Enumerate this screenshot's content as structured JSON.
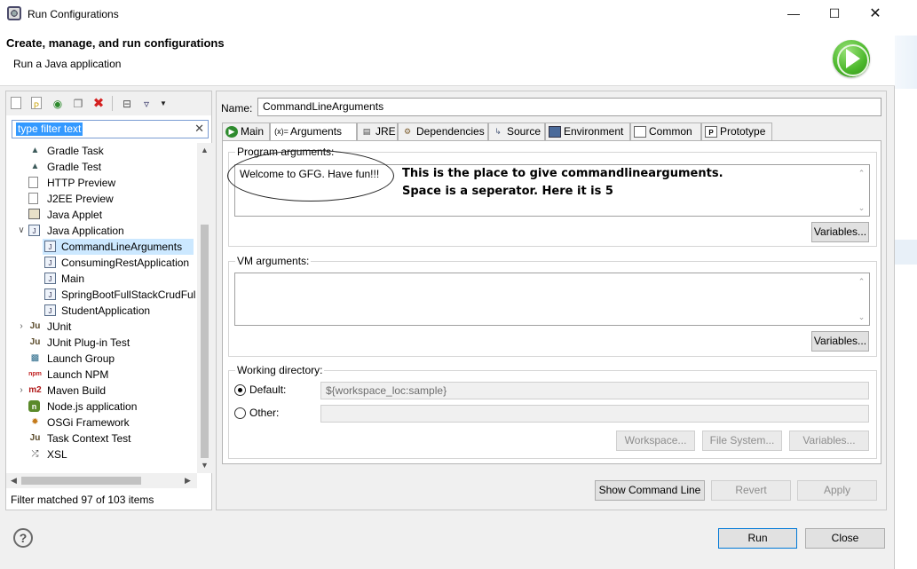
{
  "window": {
    "title": "Run Configurations",
    "header_title": "Create, manage, and run configurations",
    "header_subtitle": "Run a Java application",
    "run_badge_icon": "run-play-icon"
  },
  "left": {
    "filter_placeholder": "type filter text",
    "filter_value": "type filter text",
    "tree": [
      {
        "label": "Gradle Task",
        "icon": "gradle-icon"
      },
      {
        "label": "Gradle Test",
        "icon": "gradle-icon"
      },
      {
        "label": "HTTP Preview",
        "icon": "document-icon"
      },
      {
        "label": "J2EE Preview",
        "icon": "document-icon"
      },
      {
        "label": "Java Applet",
        "icon": "applet-icon"
      },
      {
        "label": "Java Application",
        "icon": "java-app-icon"
      },
      {
        "label": "CommandLineArguments",
        "icon": "java-app-icon"
      },
      {
        "label": "ConsumingRestApplication",
        "icon": "java-app-icon"
      },
      {
        "label": "Main",
        "icon": "java-app-icon"
      },
      {
        "label": "SpringBootFullStackCrudFul",
        "icon": "java-app-icon"
      },
      {
        "label": "StudentApplication",
        "icon": "java-app-icon"
      },
      {
        "label": "JUnit",
        "icon": "junit-icon"
      },
      {
        "label": "JUnit Plug-in Test",
        "icon": "junit-plugin-icon"
      },
      {
        "label": "Launch Group",
        "icon": "launch-group-icon"
      },
      {
        "label": "Launch NPM",
        "icon": "npm-icon"
      },
      {
        "label": "Maven Build",
        "icon": "maven-icon"
      },
      {
        "label": "Node.js application",
        "icon": "nodejs-icon"
      },
      {
        "label": "OSGi Framework",
        "icon": "osgi-icon"
      },
      {
        "label": "Task Context Test",
        "icon": "task-context-icon"
      },
      {
        "label": "XSL",
        "icon": "xsl-icon"
      }
    ],
    "status": "Filter matched 97 of 103 items"
  },
  "right": {
    "name_label": "Name:",
    "name_value": "CommandLineArguments",
    "tabs": [
      "Main",
      "Arguments",
      "JRE",
      "Dependencies",
      "Source",
      "Environment",
      "Common",
      "Prototype"
    ],
    "program_args_label": "Program arguments:",
    "program_args_value": "Welcome to GFG. Have fun!!!",
    "variables_label": "Variables...",
    "vm_args_label": "VM arguments:",
    "vm_args_value": "",
    "working_dir_label": "Working directory:",
    "default_label": "Default:",
    "default_value": "${workspace_loc:sample}",
    "other_label": "Other:",
    "other_value": "",
    "workspace_btn": "Workspace...",
    "filesystem_btn": "File System...",
    "show_cmd_btn": "Show Command Line",
    "revert_btn": "Revert",
    "apply_btn": "Apply"
  },
  "annotation": {
    "line1": "This is the place to give commandlinearguments.",
    "line2": "Space is a seperator. Here it is 5"
  },
  "footer": {
    "run_btn": "Run",
    "close_btn": "Close"
  },
  "colors": {
    "selection": "#cce8ff",
    "filter_highlight": "#3399ff",
    "primary_border": "#0078d7"
  }
}
